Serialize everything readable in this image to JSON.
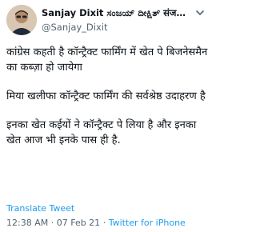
{
  "header": {
    "display_name": "Sanjay Dixit ಸಂಜಯ್ ದೀಕ್ಷಿತ್ संजय दीक्षित",
    "handle": "@Sanjay_Dixit",
    "avatar_icon": "user-avatar",
    "more_icon": "chevron-down-icon"
  },
  "tweet": {
    "paragraphs": [
      "कांग्रेस कहती है कॉन्ट्रैक्ट फार्मिंग में खेत पे बिजनेसमैन का कब्ज़ा हो जायेगा",
      "मिया खलीफा कॉन्ट्रैक्ट फार्मिंग की सर्वश्रेष्ठ उदाहरण है",
      "इनका खेत कईयों ने कॉन्ट्रैक्ट पे लिया है और इनका खेत आज भी इनके पास ही है."
    ]
  },
  "translate_label": "Translate Tweet",
  "meta": {
    "time": "12:38 AM",
    "separator": "·",
    "date": "07 Feb 21",
    "source": "Twitter for iPhone"
  },
  "colors": {
    "link": "#1d9bf0",
    "secondary": "#536471",
    "text": "#0f1419"
  }
}
